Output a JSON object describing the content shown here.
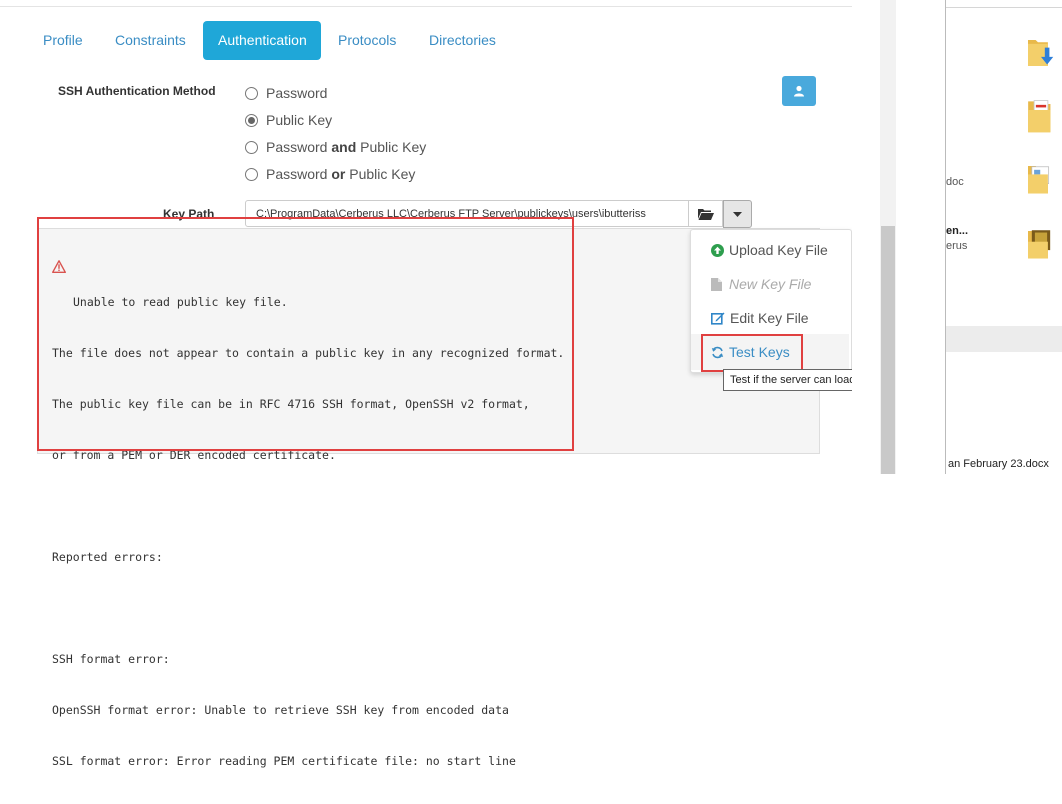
{
  "tabs": [
    {
      "label": "Profile",
      "active": false
    },
    {
      "label": "Constraints",
      "active": false
    },
    {
      "label": "Authentication",
      "active": true
    },
    {
      "label": "Protocols",
      "active": false
    },
    {
      "label": "Directories",
      "active": false
    }
  ],
  "ssh_auth": {
    "label": "SSH Authentication Method",
    "options": [
      {
        "pre": "Password",
        "bold": "",
        "post": "",
        "checked": false
      },
      {
        "pre": "Public Key",
        "bold": "",
        "post": "",
        "checked": true
      },
      {
        "pre": "Password ",
        "bold": "and",
        "post": " Public Key",
        "checked": false
      },
      {
        "pre": "Password ",
        "bold": "or",
        "post": " Public Key",
        "checked": false
      }
    ]
  },
  "key_path": {
    "label": "Key Path",
    "value": "C:\\ProgramData\\Cerberus LLC\\Cerberus FTP Server\\publickeys\\users\\ibutteriss"
  },
  "errors": {
    "lines": [
      "Unable to read public key file.",
      "The file does not appear to contain a public key in any recognized format.",
      "The public key file can be in RFC 4716 SSH format, OpenSSH v2 format,",
      "or from a PEM or DER encoded certificate.",
      "",
      "Reported errors:",
      "",
      "SSH format error:",
      "OpenSSH format error: Unable to retrieve SSH key from encoded data",
      "SSL format error: Error reading PEM certificate file: no start line"
    ]
  },
  "dropdown": {
    "upload_key_file": "Upload Key File",
    "new_key_file": "New Key File",
    "edit_key_file": "Edit Key File",
    "test_keys": "Test Keys"
  },
  "tooltip": "Test if the server can load a public key from the selected file",
  "right_panel": {
    "text_doc": "doc",
    "text_en": "en...",
    "text_erus": "erus",
    "text_file": "an February 23.docx"
  },
  "colors": {
    "accent": "#1fa7d8",
    "link": "#3a8dc4",
    "highlight_red": "#e04040"
  }
}
